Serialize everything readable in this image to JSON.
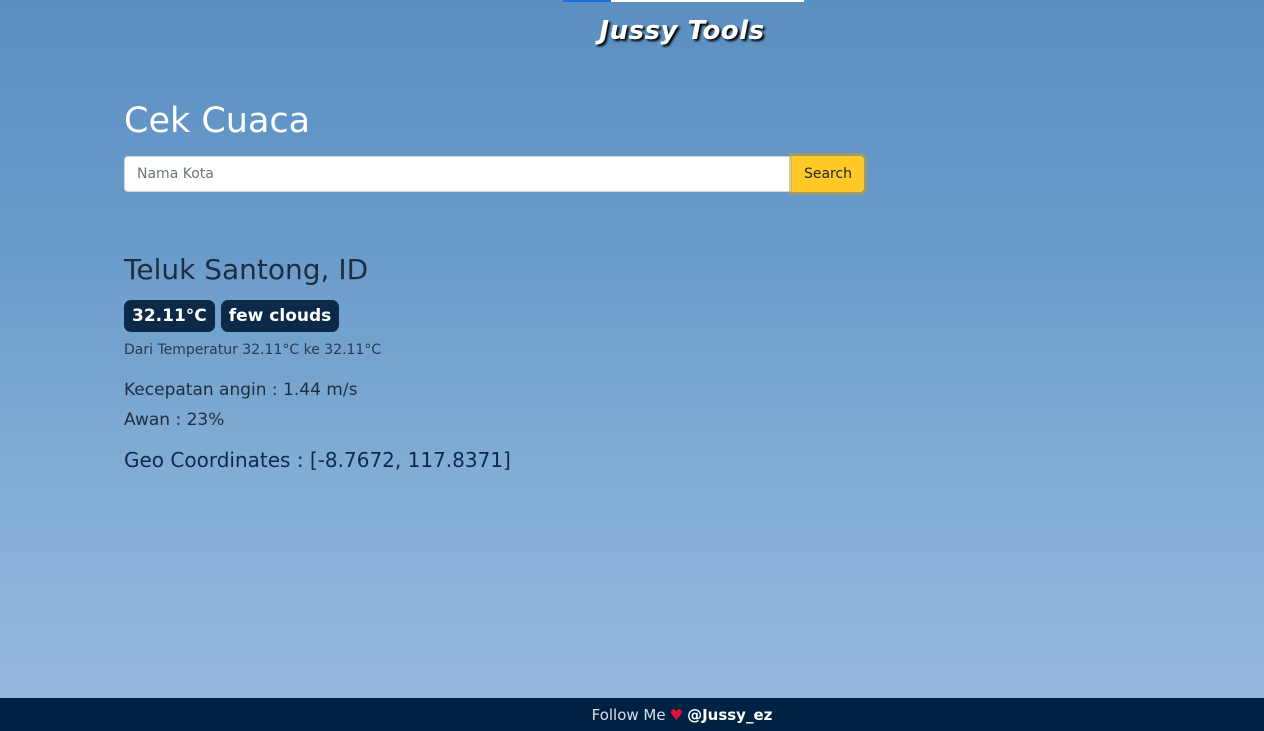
{
  "brand": {
    "title": "Jussy Tools"
  },
  "weather_form": {
    "title": "Cek Cuaca",
    "search_placeholder": "Nama Kota",
    "search_value": "",
    "search_button_label": "Search"
  },
  "result": {
    "city": "Teluk Santong, ID",
    "temperature_badge": "32.11°C",
    "description_badge": "few clouds",
    "temperature_range": "Dari Temperatur 32.11°C ke 32.11°C",
    "wind": "Kecepatan angin : 1.44 m/s",
    "clouds": "Awan : 23%",
    "geo": "Geo Coordinates : [-8.7672, 117.8371]"
  },
  "footer": {
    "follow_text": "Follow Me",
    "heart_icon": "heart-icon",
    "heart_glyph": "♥",
    "handle": "@Jussy_ez"
  },
  "colors": {
    "badge_bg": "#0c2a48",
    "search_button": "#ffc928",
    "footer_bg": "#002242",
    "heart": "#e0103a"
  }
}
